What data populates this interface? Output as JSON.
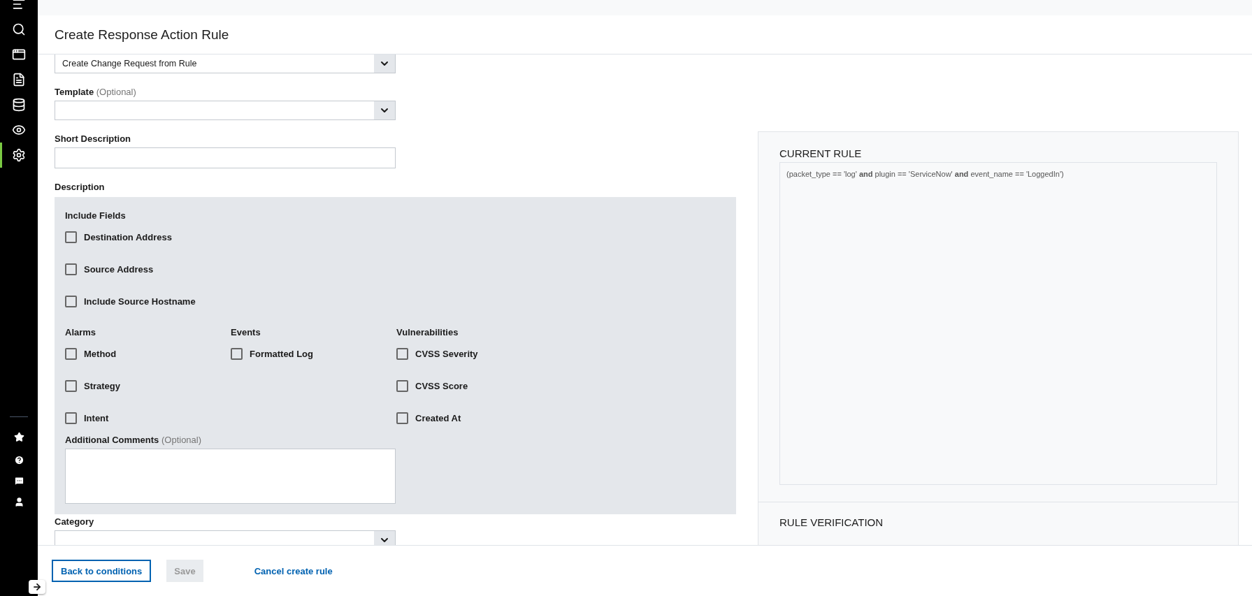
{
  "sidebar": {
    "items": [
      {
        "selected": false
      },
      {
        "selected": false
      },
      {
        "selected": false
      },
      {
        "selected": false
      },
      {
        "selected": false
      },
      {
        "selected": false
      },
      {
        "selected": true
      }
    ]
  },
  "header": {
    "title": "Create Response Action Rule"
  },
  "form": {
    "action": {
      "value": "Create Change Request from Rule"
    },
    "template": {
      "label": "Template",
      "optional": "(Optional)"
    },
    "short_description": {
      "label": "Short Description"
    },
    "description": {
      "label": "Description",
      "include_fields": {
        "heading": "Include Fields",
        "options": [
          {
            "label": "Destination Address",
            "checked": false
          },
          {
            "label": "Source Address",
            "checked": false
          },
          {
            "label": "Include Source Hostname",
            "checked": false
          }
        ]
      },
      "groups": [
        {
          "heading": "Alarms",
          "options": [
            {
              "label": "Method",
              "checked": false
            },
            {
              "label": "Strategy",
              "checked": false
            },
            {
              "label": "Intent",
              "checked": false
            }
          ]
        },
        {
          "heading": "Events",
          "options": [
            {
              "label": "Formatted Log",
              "checked": false
            }
          ]
        },
        {
          "heading": "Vulnerabilities",
          "options": [
            {
              "label": "CVSS Severity",
              "checked": false
            },
            {
              "label": "CVSS Score",
              "checked": false
            },
            {
              "label": "Created At",
              "checked": false
            }
          ]
        }
      ],
      "additional_comments": {
        "label": "Additional Comments",
        "optional": "(Optional)"
      }
    },
    "category": {
      "label": "Category"
    }
  },
  "current_rule": {
    "title": "CURRENT RULE",
    "rule": "(packet_type == 'log' **and** plugin == 'ServiceNow' **and** event_name == 'LoggedIn')"
  },
  "rule_verification": {
    "title": "RULE VERIFICATION"
  },
  "footer": {
    "buttons": [
      {
        "label": "Back to conditions",
        "kind": "outline",
        "disabled": false
      },
      {
        "label": "Save",
        "kind": "filled",
        "disabled": true
      },
      {
        "label": "Cancel create rule",
        "kind": "link",
        "disabled": false
      }
    ]
  }
}
